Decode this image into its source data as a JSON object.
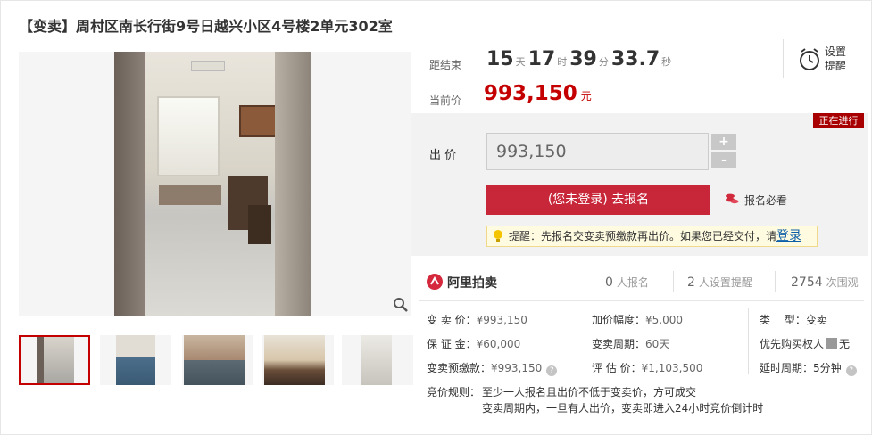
{
  "title": "【变卖】周村区南长行街9号日越兴小区4号楼2单元302室",
  "countdown": {
    "label": "距结束",
    "days": "15",
    "days_unit": "天",
    "hours": "17",
    "hours_unit": "时",
    "minutes": "39",
    "minutes_unit": "分",
    "seconds": "33.7",
    "seconds_unit": "秒"
  },
  "remind": {
    "label": "设置提醒"
  },
  "current_price": {
    "label": "当前价",
    "value": "993,150",
    "unit": "元"
  },
  "status_badge": "正在进行",
  "bid": {
    "label": "出 价",
    "value": "993,150",
    "plus": "+",
    "minus": "-"
  },
  "signup_button": "(您未登录) 去报名",
  "must_read": "报名必看",
  "tip": {
    "text": "提醒：先报名交变卖预缴款再出价。如果您已经交付，请",
    "link": "登录"
  },
  "platform": "阿里拍卖",
  "stats": [
    {
      "num": "0",
      "label": "人报名"
    },
    {
      "num": "2",
      "label": "人设置提醒"
    },
    {
      "num": "2754",
      "label": "次围观"
    }
  ],
  "info": {
    "sale_price": {
      "key": "变 卖 价：",
      "value": "¥993,150"
    },
    "deposit": {
      "key": "保 证 金：",
      "value": "¥60,000"
    },
    "prepay": {
      "key": "变卖预缴款：",
      "value": "¥993,150"
    },
    "increment": {
      "key": "加价幅度：",
      "value": "¥5,000"
    },
    "period": {
      "key": "变卖周期：",
      "value": "60天"
    },
    "appraisal": {
      "key": "评 估 价：",
      "value": "¥1,103,500"
    },
    "type": {
      "key": "类　 型：",
      "value": "变卖"
    },
    "priority": {
      "key": "优先购买权人",
      "value": "无"
    },
    "delay": {
      "key": "延时周期：",
      "value": "5分钟"
    }
  },
  "rules": {
    "label": "竞价规则：",
    "line1": "至少一人报名且出价不低于变卖价，方可成交",
    "line2": "变卖周期内，一旦有人出价，变卖即进入24小时竞价倒计时"
  },
  "colors": {
    "accent": "#c40000",
    "button": "#c8273a",
    "badge": "#a80000",
    "link": "#0c5ea8"
  }
}
